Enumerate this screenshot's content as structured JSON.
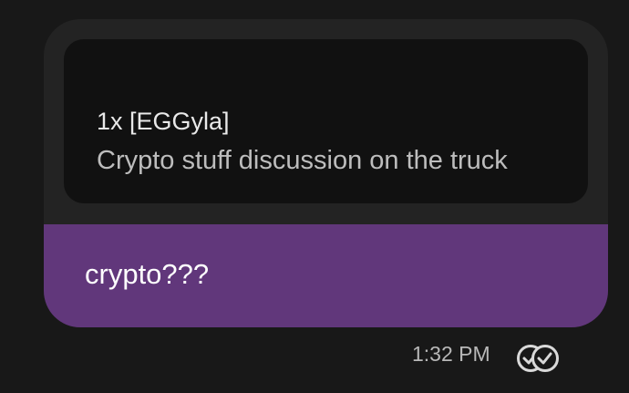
{
  "message": {
    "quote": {
      "title": "1x [EGGyla]",
      "text": "Crypto stuff discussion on the truck"
    },
    "body": "crypto???",
    "time": "1:32 PM",
    "status_icon": "double-check-icon"
  },
  "colors": {
    "background": "#181818",
    "bubble": "#232323",
    "quote_panel": "#111111",
    "message_accent": "#61377b"
  }
}
